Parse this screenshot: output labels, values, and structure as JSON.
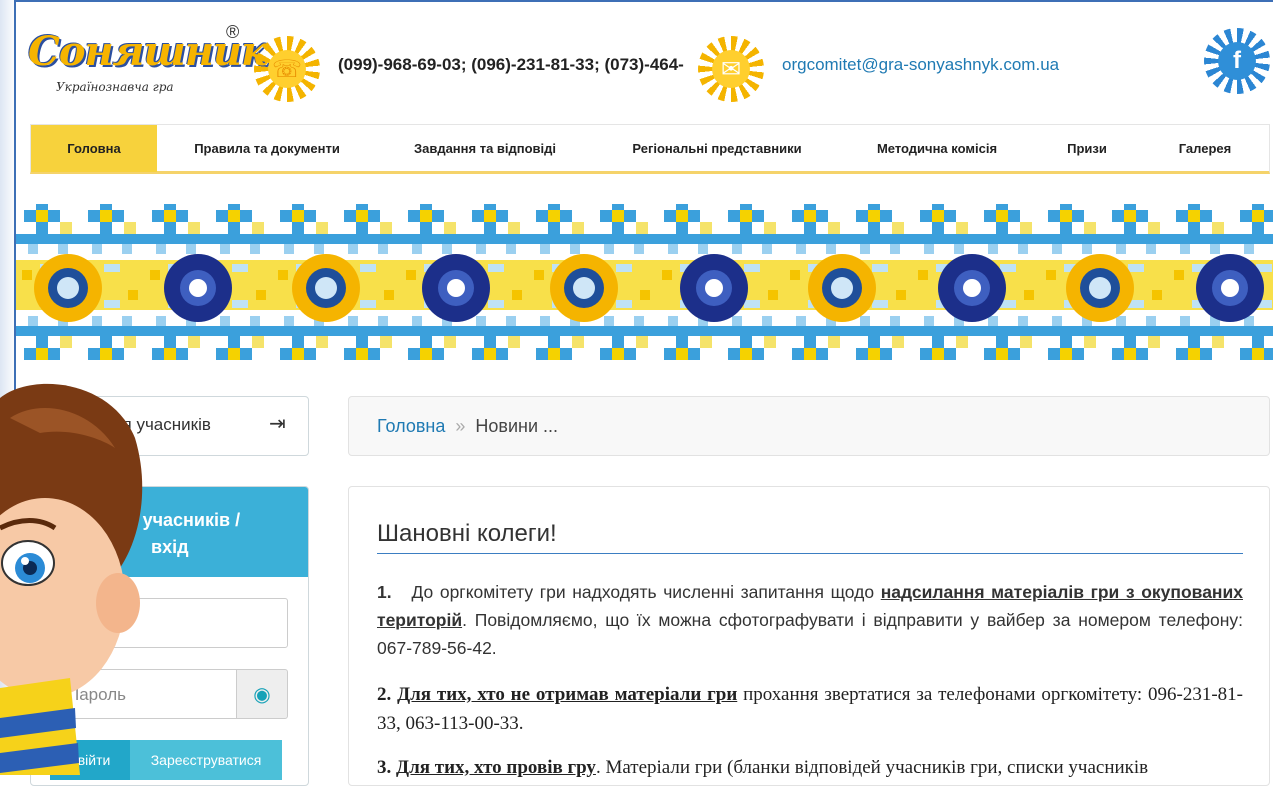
{
  "header": {
    "logo_text": "Соняшник",
    "logo_subtitle": "Українознавча гра",
    "logo_reg": "®",
    "phones": "(099)-968-69-03; (096)-231-81-33; (073)-464-",
    "email": "orgcomitet@gra-sonyashnyk.com.ua",
    "icons": [
      "phone-icon",
      "mail-icon",
      "facebook-icon"
    ]
  },
  "nav": {
    "items": [
      {
        "label": "Головна",
        "active": true
      },
      {
        "label": "Правила та документи"
      },
      {
        "label": "Завдання та відповіді"
      },
      {
        "label": "Регіональні представники"
      },
      {
        "label": "Методична комісія"
      },
      {
        "label": "Призи"
      },
      {
        "label": "Галерея"
      }
    ]
  },
  "sidebar": {
    "panel1_title": "ція учасників",
    "panel2_title_line1": "ція учасників /",
    "panel2_title_line2": "вхід",
    "password_placeholder": "Пароль",
    "login_button": "Увійти",
    "register_button": "Зареєструватися"
  },
  "breadcrumb": {
    "home": "Головна",
    "separator": "»",
    "current": "Новини ..."
  },
  "content": {
    "title": "Шановні колеги!",
    "p1_num": "1.",
    "p1_text_a": "До оргкомітету гри надходять численні запитання щодо",
    "p1_link": "надсилання матеріалів гри з окупованих територій",
    "p1_text_b": ". Повідомляємо, що їх можна сфотографувати і відправити у вайбер за номером телефону: 067-789-56-42.",
    "p2_num": "2.",
    "p2_link": "Для тих, хто не отримав матеріали гри",
    "p2_text": " прохання звертатися за телефонами оргкомітету: 096-231-81-33, 063-113-00-33.",
    "p3_num": "3.",
    "p3_link": "Для тих, хто провів гру",
    "p3_text": ". Матеріали гри (бланки відповідей учасників гри, списки учасників"
  },
  "colors": {
    "nav_active": "#f7d23c",
    "accent_blue": "#3bb0d8",
    "link": "#1f7ab3"
  }
}
